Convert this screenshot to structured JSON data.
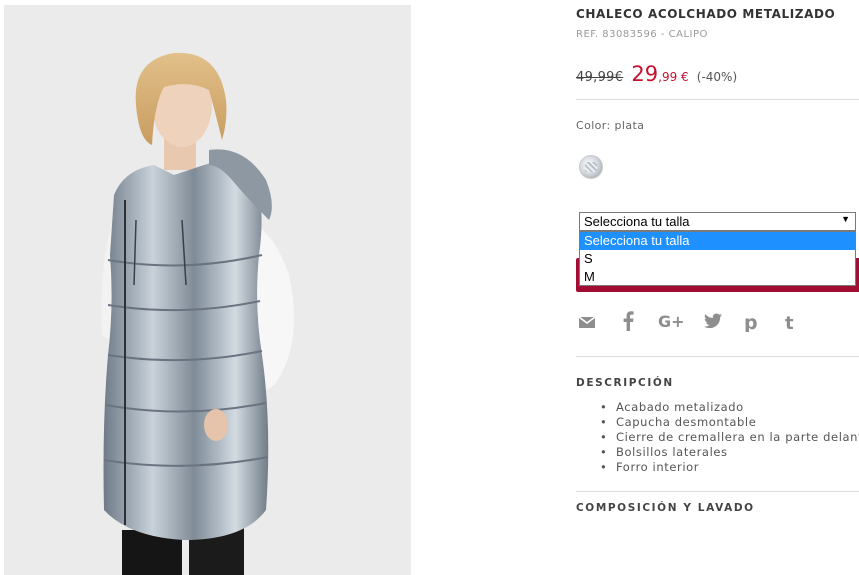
{
  "product": {
    "title": "CHALECO ACOLCHADO METALIZADO",
    "ref": "REF. 83083596 - CALIPO",
    "old_price": "49,99€",
    "new_price_int": "29",
    "new_price_dec": ",99 €",
    "discount": "(-40%)",
    "color_label": "Color: plata"
  },
  "size_select": {
    "selected": "Selecciona tu talla",
    "options": [
      "Selecciona tu talla",
      "S",
      "M"
    ]
  },
  "share_icons": [
    "email-icon",
    "facebook-icon",
    "google-plus-icon",
    "twitter-icon",
    "pinterest-icon",
    "tumblr-icon"
  ],
  "description": {
    "heading": "DESCRIPCIÓN",
    "items": [
      "Acabado metalizado",
      "Capucha desmontable",
      "Cierre de cremallera en la parte delantera",
      "Bolsillos laterales",
      "Forro interior"
    ]
  },
  "composition": {
    "heading": "COMPOSICIÓN Y LAVADO"
  },
  "colors": {
    "price_red": "#c8102e",
    "button": "#a20d33",
    "highlight": "#1e90ff"
  }
}
